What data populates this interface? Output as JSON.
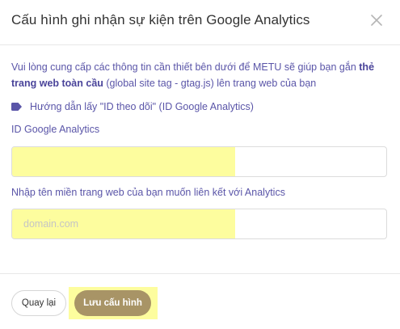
{
  "header": {
    "title": "Cấu hình ghi nhận sự kiện trên Google Analytics",
    "close_icon": "close-icon"
  },
  "intro": {
    "text_before": "Vui lòng cung cấp các thông tin cần thiết bên dưới để METU sẽ giúp bạn gắn ",
    "bold_text": "thẻ trang web toàn cầu",
    "text_after": " (global site tag - gtag.js) lên trang web của bạn"
  },
  "guide": {
    "icon": "tag-icon",
    "label": "Hướng dẫn lấy \"ID theo dõi\" (ID Google Analytics)"
  },
  "fields": {
    "ga_id": {
      "label": "ID Google Analytics",
      "value": "",
      "placeholder": ""
    },
    "domain": {
      "label": "Nhập tên miền trang web của bạn muốn liên kết với Analytics",
      "value": "",
      "placeholder": "domain.com"
    }
  },
  "footer": {
    "back_label": "Quay lại",
    "save_label": "Lưu cấu hình"
  },
  "colors": {
    "accent_text": "#5a55a8",
    "save_button": "#a89466",
    "highlight": "#fdfd9e"
  }
}
